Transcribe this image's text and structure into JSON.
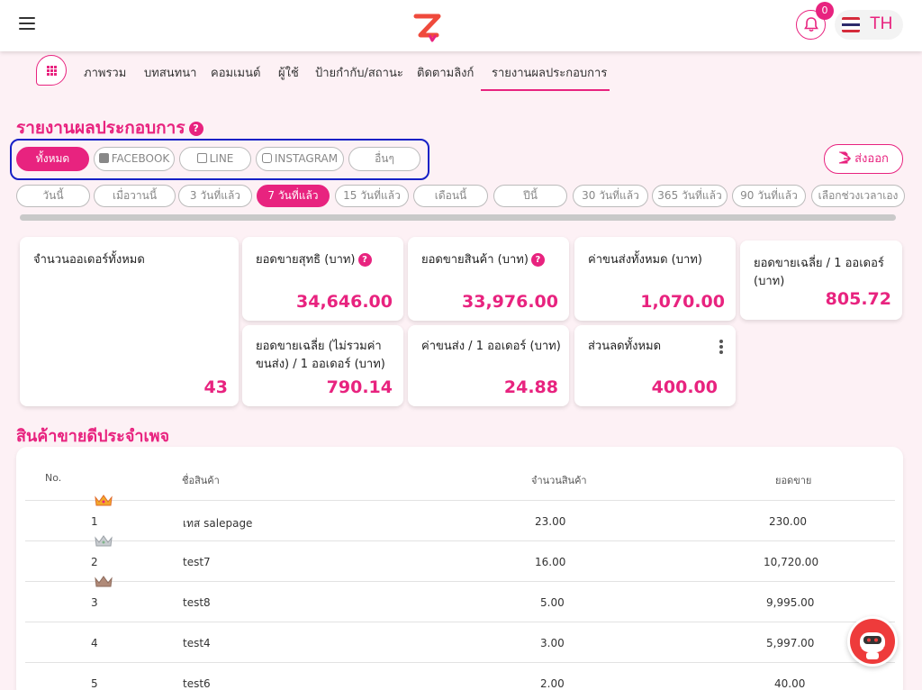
{
  "header": {
    "notification_count": "0",
    "language": "TH"
  },
  "nav": {
    "items": [
      "ภาพรวม",
      "บทสนทนา",
      "คอมเมนต์",
      "ผู้ใช้",
      "ป้ายกำกับ/สถานะ",
      "ติดตามลิงก์",
      "รายงานผลประกอบการ"
    ],
    "active_index": 6
  },
  "page": {
    "title": "รายงานผลประกอบการ",
    "export_label": "ส่งออก"
  },
  "channels": [
    "ทั้งหมด",
    "FACEBOOK",
    "LINE",
    "INSTAGRAM",
    "อื่นๆ"
  ],
  "date_ranges": [
    "วันนี้",
    "เมื่อวานนี้",
    "3 วันที่แล้ว",
    "7 วันที่แล้ว",
    "15 วันที่แล้ว",
    "เดือนนี้",
    "ปีนี้",
    "30 วันที่แล้ว",
    "365 วันที่แล้ว",
    "90 วันที่แล้ว",
    "เลือกช่วงเวลาเอง"
  ],
  "stats": {
    "total_orders": {
      "label": "จำนวนออเดอร์ทั้งหมด",
      "value": "43"
    },
    "net_sales": {
      "label": "ยอดขายสุทธิ (บาท)",
      "value": "34,646.00"
    },
    "product_sales": {
      "label": "ยอดขายสินค้า (บาท)",
      "value": "33,976.00"
    },
    "total_shipping": {
      "label": "ค่าขนส่งทั้งหมด (บาท)",
      "value": "1,070.00"
    },
    "avg_sales_per_order": {
      "label": "ยอดขายเฉลี่ย / 1 ออเดอร์ (บาท)",
      "value": "805.72"
    },
    "avg_sales_excl_shipping": {
      "label": "ยอดขายเฉลี่ย (ไม่รวมค่าขนส่ง) / 1 ออเดอร์ (บาท)",
      "value": "790.14"
    },
    "shipping_per_order": {
      "label": "ค่าขนส่ง / 1 ออเดอร์ (บาท)",
      "value": "24.88"
    },
    "total_discount": {
      "label": "ส่วนลดทั้งหมด",
      "value": "400.00"
    }
  },
  "best_sellers": {
    "title": "สินค้าขายดีประจำเพจ",
    "columns": [
      "No.",
      "ชื่อสินค้า",
      "จำนวนสินค้า",
      "ยอดขาย"
    ],
    "rows": [
      {
        "no": "1",
        "name": "เทส salepage",
        "qty": "23.00",
        "sales": "230.00"
      },
      {
        "no": "2",
        "name": "test7",
        "qty": "16.00",
        "sales": "10,720.00"
      },
      {
        "no": "3",
        "name": "test8",
        "qty": "5.00",
        "sales": "9,995.00"
      },
      {
        "no": "4",
        "name": "test4",
        "qty": "3.00",
        "sales": "5,997.00"
      },
      {
        "no": "5",
        "name": "test6",
        "qty": "2.00",
        "sales": "40.00"
      }
    ]
  },
  "colors": {
    "accent": "#e8237f",
    "highlight_box": "#1620c6",
    "background": "#fdf1f5"
  }
}
